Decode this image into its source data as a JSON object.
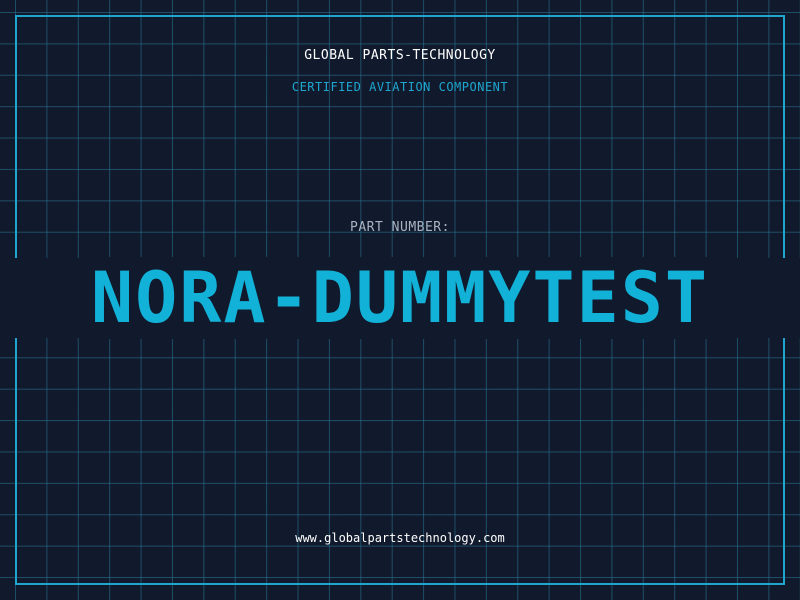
{
  "header": {
    "company": "GLOBAL PARTS-TECHNOLOGY",
    "tagline": "CERTIFIED AVIATION COMPONENT"
  },
  "part": {
    "label": "PART NUMBER:",
    "number": "NORA-DUMMYTEST"
  },
  "footer": {
    "website": "www.globalpartstechnology.com"
  },
  "colors": {
    "background": "#111a2d",
    "accent": "#1fa6cf",
    "grid": "#28788f",
    "text": "#ffffff",
    "muted": "#a9b4c2"
  }
}
